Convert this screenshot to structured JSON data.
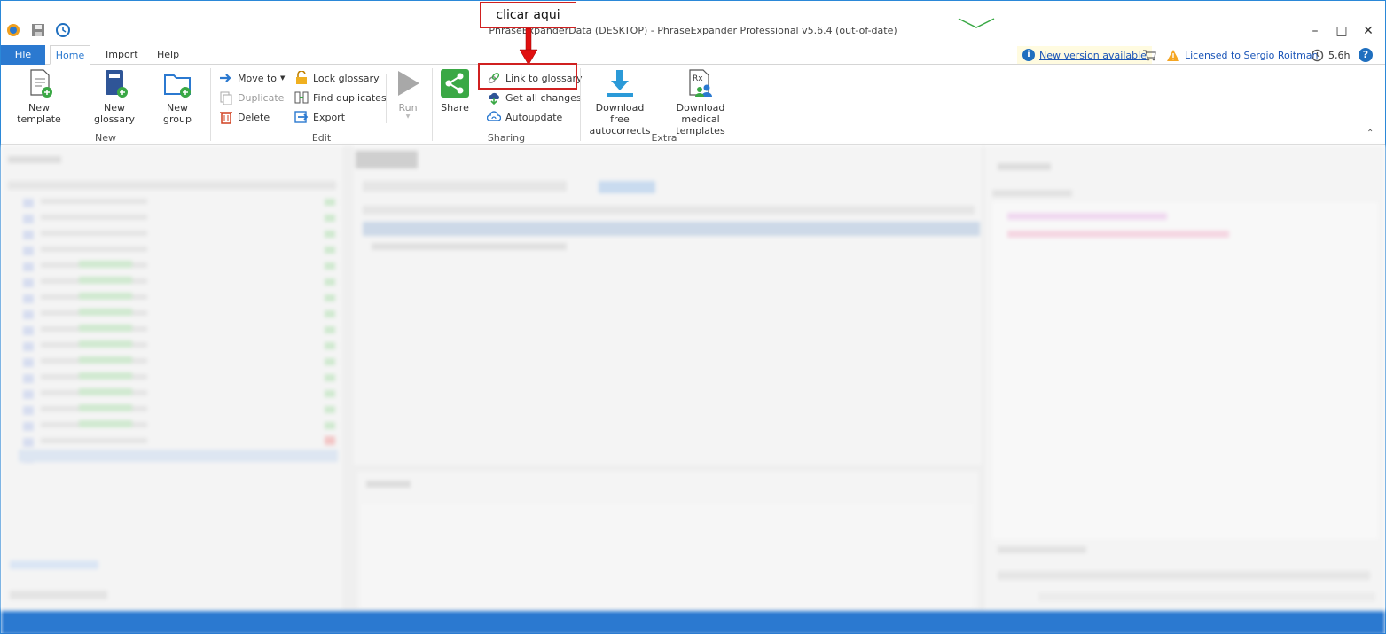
{
  "window": {
    "title": "PhraseExpanderData (DESKTOP) - PhraseExpander Professional v5.6.4 (out-of-date)"
  },
  "menu": {
    "tabs": [
      "File",
      "Home",
      "Import",
      "Help"
    ]
  },
  "header_right": {
    "new_version": "New version available",
    "licensed": "Licensed to Sergio Roitman",
    "time": "5,6h"
  },
  "ribbon": {
    "new_group": {
      "label": "New",
      "new_template": "New template",
      "new_glossary": "New glossary",
      "new_group": "New group"
    },
    "edit_group": {
      "label": "Edit",
      "move_to": "Move to",
      "duplicate": "Duplicate",
      "delete": "Delete",
      "lock_glossary": "Lock glossary",
      "find_duplicates": "Find duplicates",
      "export": "Export",
      "run": "Run"
    },
    "sharing_group": {
      "label": "Sharing",
      "share": "Share",
      "link_to_glossary": "Link to glossary",
      "get_all_changes": "Get all changes",
      "autoupdate": "Autoupdate"
    },
    "extra_group": {
      "label": "Extra",
      "download_autocorrects_line1": "Download free",
      "download_autocorrects_line2": "autocorrects",
      "download_medical_line1": "Download medical",
      "download_medical_line2": "templates"
    }
  },
  "annotation": {
    "callout": "clicar aqui"
  },
  "colors": {
    "accent": "#2b79d0",
    "highlight": "#d02020",
    "share_green": "#3aa845"
  },
  "icons": [
    "app-logo-icon",
    "save-icon",
    "clock-icon",
    "info-icon",
    "cart-icon",
    "warning-icon",
    "help-icon"
  ]
}
